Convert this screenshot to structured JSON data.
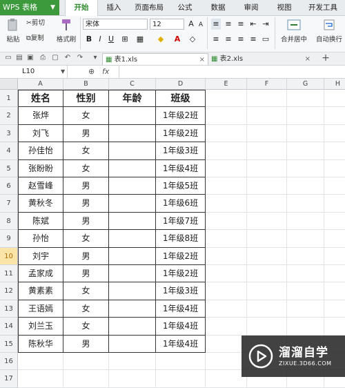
{
  "app": {
    "title": "WPS 表格"
  },
  "menu": {
    "tabs": [
      "开始",
      "插入",
      "页面布局",
      "公式",
      "数据",
      "审阅",
      "视图",
      "开发工具"
    ],
    "active": "开始"
  },
  "ribbon": {
    "paste": "粘贴",
    "cut": "剪切",
    "copy": "复制",
    "format_painter": "格式刷",
    "font_name": "宋体",
    "font_size": "12",
    "merge_center": "合并居中",
    "wrap_text": "自动换行"
  },
  "doc_tabs": [
    "表1.xls",
    "表2.xls"
  ],
  "namebox": "L10",
  "fx": "fx",
  "columns": [
    "A",
    "B",
    "C",
    "D",
    "E",
    "F",
    "G",
    "H"
  ],
  "rows": [
    "1",
    "2",
    "3",
    "4",
    "5",
    "6",
    "7",
    "8",
    "9",
    "10",
    "11",
    "12",
    "13",
    "14",
    "15",
    "16",
    "17"
  ],
  "selected_row": "10",
  "table": {
    "headers": [
      "姓名",
      "性别",
      "年龄",
      "班级"
    ],
    "rows": [
      [
        "张烨",
        "女",
        "",
        "1年级2班"
      ],
      [
        "刘飞",
        "男",
        "",
        "1年级2班"
      ],
      [
        "孙佳怡",
        "女",
        "",
        "1年级3班"
      ],
      [
        "张盼盼",
        "女",
        "",
        "1年级4班"
      ],
      [
        "赵雪峰",
        "男",
        "",
        "1年级5班"
      ],
      [
        "黄秋冬",
        "男",
        "",
        "1年级6班"
      ],
      [
        "陈斌",
        "男",
        "",
        "1年级7班"
      ],
      [
        "孙怡",
        "女",
        "",
        "1年级8班"
      ],
      [
        "刘宇",
        "男",
        "",
        "1年级2班"
      ],
      [
        "孟家成",
        "男",
        "",
        "1年级2班"
      ],
      [
        "黄素素",
        "女",
        "",
        "1年级3班"
      ],
      [
        "王语嫣",
        "女",
        "",
        "1年级4班"
      ],
      [
        "刘兰玉",
        "女",
        "",
        "1年级4班"
      ],
      [
        "陈秋华",
        "男",
        "",
        "1年级4班"
      ]
    ]
  },
  "watermark": {
    "title": "溜溜自学",
    "subtitle": "ZIXUE.3D66.COM"
  }
}
